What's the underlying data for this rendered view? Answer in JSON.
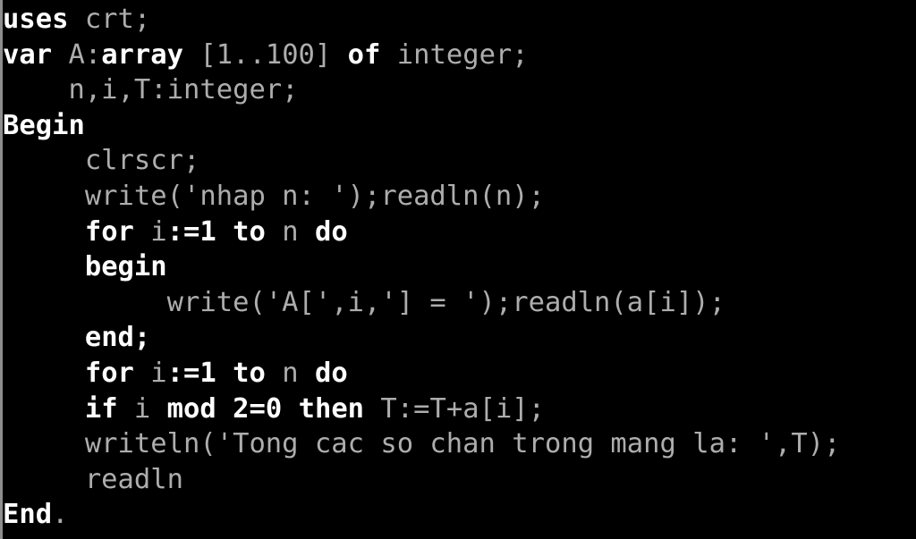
{
  "screen": {
    "title": "Pascal source code listing",
    "background_color": "#000000",
    "keyword_color": "#ffffff",
    "identifier_color": "#adadad",
    "edge_color": "#8e8e8e",
    "language": "Pascal"
  },
  "code": {
    "lines": [
      {
        "indent": "",
        "text": "uses crt;",
        "tokens": [
          {
            "t": "uses",
            "kind": "kw"
          },
          {
            "t": " crt;",
            "kind": "id"
          }
        ]
      },
      {
        "indent": "",
        "text": "var A:array [1..100] of integer;",
        "tokens": [
          {
            "t": "var",
            "kind": "kw"
          },
          {
            "t": " A:",
            "kind": "id"
          },
          {
            "t": "array",
            "kind": "kw"
          },
          {
            "t": " [1..100] ",
            "kind": "id"
          },
          {
            "t": "of",
            "kind": "kw"
          },
          {
            "t": " integer;",
            "kind": "id"
          }
        ]
      },
      {
        "indent": "    ",
        "text": "    n,i,T:integer;",
        "tokens": [
          {
            "t": "    n,i,T:integer;",
            "kind": "id"
          }
        ]
      },
      {
        "indent": "",
        "text": "Begin",
        "tokens": [
          {
            "t": "Begin",
            "kind": "kw"
          }
        ]
      },
      {
        "indent": "     ",
        "text": "     clrscr;",
        "tokens": [
          {
            "t": "     clrscr;",
            "kind": "id"
          }
        ]
      },
      {
        "indent": "     ",
        "text": "     write('nhap n: ');readln(n);",
        "tokens": [
          {
            "t": "     write('nhap n: ');readln(n);",
            "kind": "id"
          }
        ]
      },
      {
        "indent": "     ",
        "text": "     for i:=1 to n do",
        "tokens": [
          {
            "t": "     ",
            "kind": "id"
          },
          {
            "t": "for",
            "kind": "kw"
          },
          {
            "t": " i",
            "kind": "id"
          },
          {
            "t": ":=1",
            "kind": "kw"
          },
          {
            "t": " ",
            "kind": "id"
          },
          {
            "t": "to",
            "kind": "kw"
          },
          {
            "t": " n ",
            "kind": "id"
          },
          {
            "t": "do",
            "kind": "kw"
          }
        ]
      },
      {
        "indent": "     ",
        "text": "     begin",
        "tokens": [
          {
            "t": "     ",
            "kind": "id"
          },
          {
            "t": "begin",
            "kind": "kw"
          }
        ]
      },
      {
        "indent": "          ",
        "text": "          write('A[',i,'] = ');readln(a[i]);",
        "tokens": [
          {
            "t": "          write('A[',i,'] = ');readln(a[i]);",
            "kind": "id"
          }
        ]
      },
      {
        "indent": "     ",
        "text": "     end;",
        "tokens": [
          {
            "t": "     ",
            "kind": "id"
          },
          {
            "t": "end;",
            "kind": "kw"
          }
        ]
      },
      {
        "indent": "     ",
        "text": "     for i:=1 to n do",
        "tokens": [
          {
            "t": "     ",
            "kind": "id"
          },
          {
            "t": "for",
            "kind": "kw"
          },
          {
            "t": " i",
            "kind": "id"
          },
          {
            "t": ":=1",
            "kind": "kw"
          },
          {
            "t": " ",
            "kind": "id"
          },
          {
            "t": "to",
            "kind": "kw"
          },
          {
            "t": " n ",
            "kind": "id"
          },
          {
            "t": "do",
            "kind": "kw"
          }
        ]
      },
      {
        "indent": "     ",
        "text": "     if i mod 2=0 then T:=T+a[i];",
        "tokens": [
          {
            "t": "     ",
            "kind": "id"
          },
          {
            "t": "if",
            "kind": "kw"
          },
          {
            "t": " i ",
            "kind": "id"
          },
          {
            "t": "mod",
            "kind": "kw"
          },
          {
            "t": " ",
            "kind": "id"
          },
          {
            "t": "2=0",
            "kind": "kw"
          },
          {
            "t": " ",
            "kind": "id"
          },
          {
            "t": "then",
            "kind": "kw"
          },
          {
            "t": " T:=T+a[i];",
            "kind": "id"
          }
        ]
      },
      {
        "indent": "     ",
        "text": "     writeln('Tong cac so chan trong mang la: ',T);",
        "tokens": [
          {
            "t": "     writeln('Tong cac so chan trong mang la: ',T);",
            "kind": "id"
          }
        ]
      },
      {
        "indent": "     ",
        "text": "     readln",
        "tokens": [
          {
            "t": "     readln",
            "kind": "id"
          }
        ]
      },
      {
        "indent": "",
        "text": "End.",
        "tokens": [
          {
            "t": "End",
            "kind": "kw"
          },
          {
            "t": ".",
            "kind": "id"
          }
        ]
      }
    ]
  }
}
